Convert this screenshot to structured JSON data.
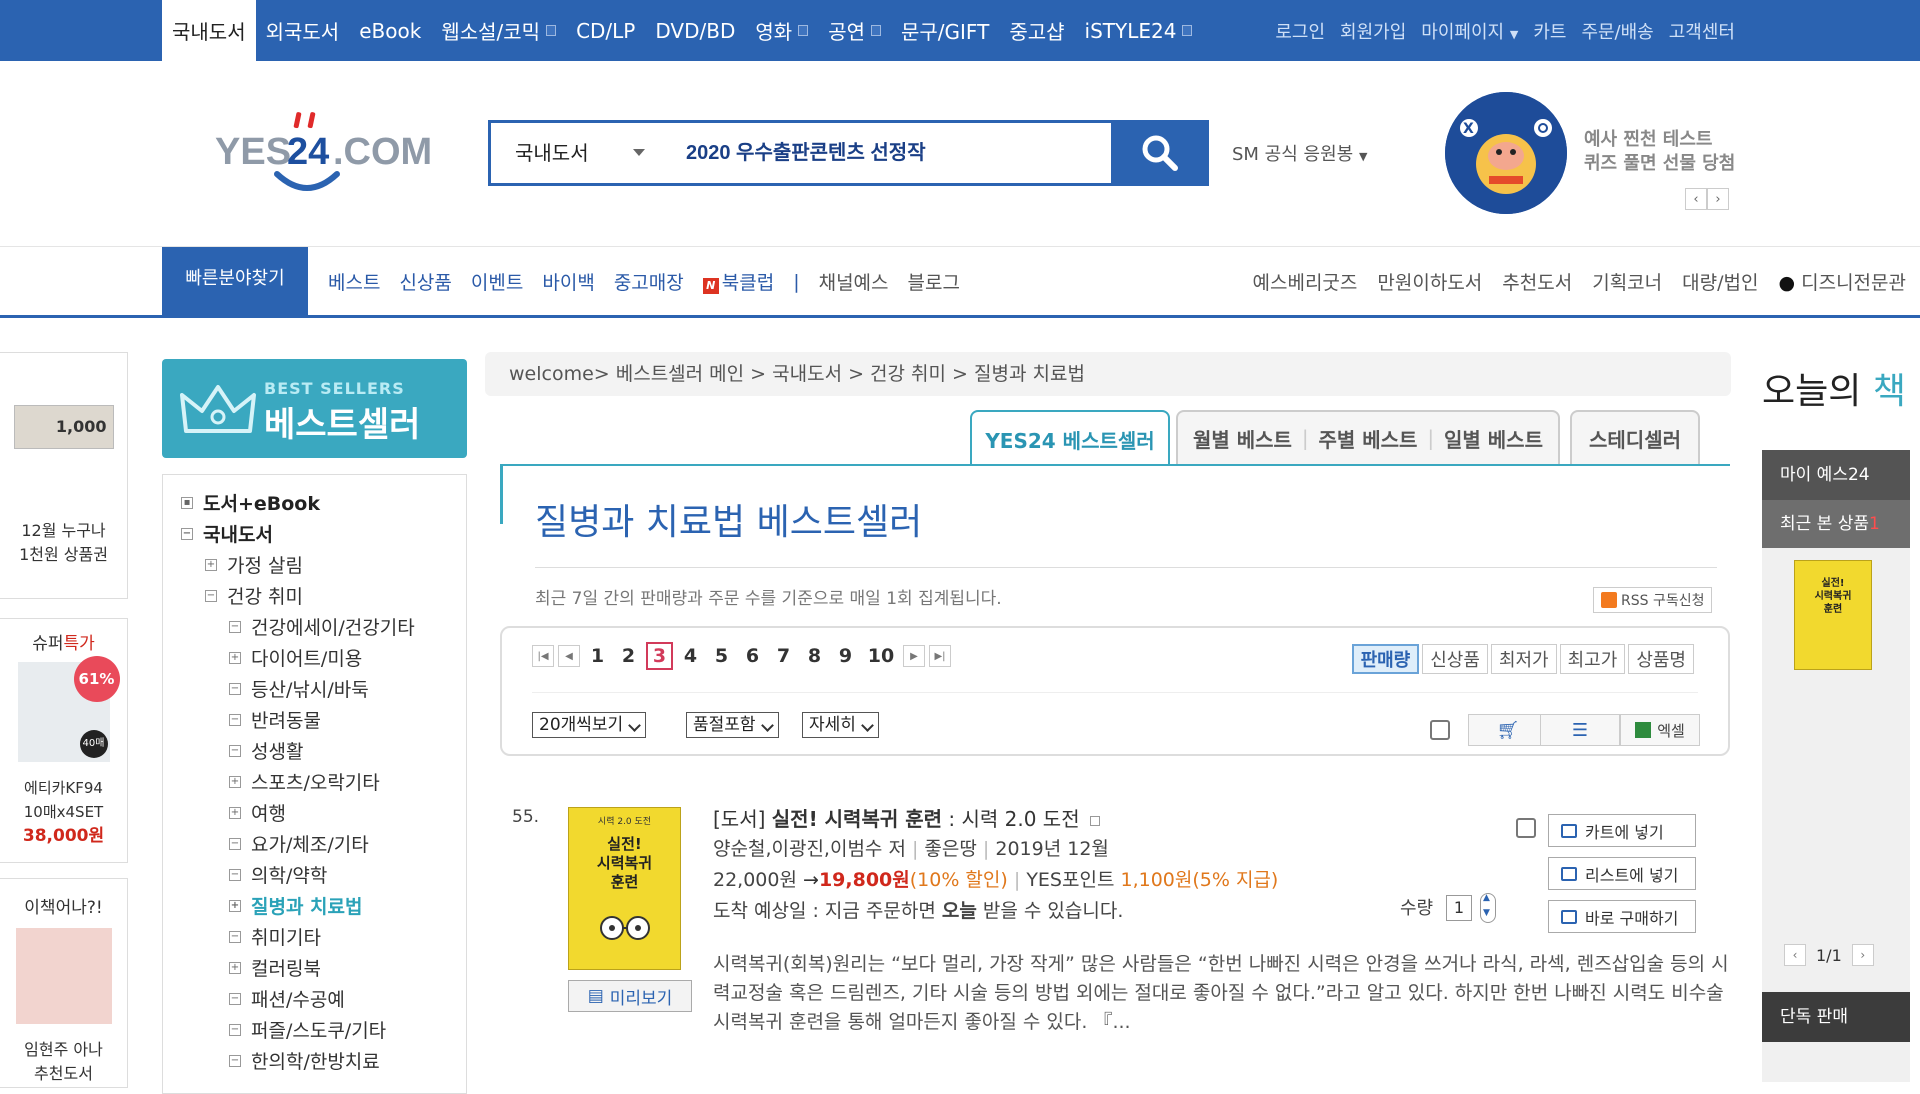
{
  "topbar": {
    "categories": [
      "국내도서",
      "외국도서",
      "eBook",
      "웹소설/코믹",
      "CD/LP",
      "DVD/BD",
      "영화",
      "공연",
      "문구/GIFT",
      "중고샵",
      "iSTYLE24"
    ],
    "util": [
      "로그인",
      "회원가입",
      "마이페이지",
      "카트",
      "주문/배송",
      "고객센터"
    ]
  },
  "logo": {
    "text_left": "YES",
    "text_num": "24",
    "text_right": ".COM"
  },
  "search": {
    "category": "국내도서",
    "keyword": "2020 우수출판콘텐츠 선정작"
  },
  "sm_support": "SM 공식 응원봉",
  "promo": {
    "line1": "예사 찐천 테스트",
    "line2": "퀴즈 풀면 선물 당첨"
  },
  "nav2": {
    "quick": "빠른분야찾기",
    "left": [
      "베스트",
      "신상품",
      "이벤트",
      "바이백",
      "중고매장",
      "북클럽",
      "채널예스",
      "블로그"
    ],
    "right": [
      "예스베리굿즈",
      "만원이하도서",
      "추천도서",
      "기획코너",
      "대량/법인",
      "디즈니전문관"
    ]
  },
  "left_ads": [
    {
      "price_img": "1,000",
      "label1": "12월 누구나",
      "label2": "1천원 상품권"
    },
    {
      "head_black": "슈퍼",
      "head_red": "특가",
      "badge": "61%",
      "count": "40매",
      "name1": "에티카KF94",
      "name2": "10매x4SET",
      "price": "38,000원"
    },
    {
      "head": "이책어나?!",
      "name1": "임현주 아나",
      "name2": "추천도서"
    }
  ],
  "bestseller": {
    "en": "BEST SELLERS",
    "ko": "베스트셀러"
  },
  "tree": [
    {
      "label": "도서+eBook",
      "level": 0
    },
    {
      "label": "국내도서",
      "level": 0
    },
    {
      "label": "가정 살림",
      "level": 1
    },
    {
      "label": "건강 취미",
      "level": 1
    },
    {
      "label": "건강에세이/건강기타",
      "level": 2
    },
    {
      "label": "다이어트/미용",
      "level": 2
    },
    {
      "label": "등산/낚시/바둑",
      "level": 2
    },
    {
      "label": "반려동물",
      "level": 2
    },
    {
      "label": "성생활",
      "level": 2
    },
    {
      "label": "스포츠/오락기타",
      "level": 2
    },
    {
      "label": "여행",
      "level": 2
    },
    {
      "label": "요가/체조/기타",
      "level": 2
    },
    {
      "label": "의학/약학",
      "level": 2
    },
    {
      "label": "질병과 치료법",
      "level": 2
    },
    {
      "label": "취미기타",
      "level": 2
    },
    {
      "label": "컬러링북",
      "level": 2
    },
    {
      "label": "패션/수공예",
      "level": 2
    },
    {
      "label": "퍼즐/스도쿠/기타",
      "level": 2
    },
    {
      "label": "한의학/한방치료",
      "level": 2
    }
  ],
  "breadcrumb": "welcome> 베스트셀러 메인 > 국내도서 > 건강 취미 > 질병과 치료법",
  "tabs": [
    "YES24 베스트셀러",
    "월별 베스트",
    "주별 베스트",
    "일별 베스트",
    "스테디셀러"
  ],
  "heading": "질병과 치료법 베스트셀러",
  "note": "최근 7일 간의 판매량과 주문 수를 기준으로 매일 1회 집계됩니다.",
  "rss": "RSS 구독신청",
  "pager": {
    "pages": [
      "1",
      "2",
      "3",
      "4",
      "5",
      "6",
      "7",
      "8",
      "9",
      "10"
    ],
    "current": "3"
  },
  "sorts": [
    "판매량",
    "신상품",
    "최저가",
    "최고가",
    "상품명"
  ],
  "dropdowns": [
    "20개씩보기",
    "품절포함",
    "자세히"
  ],
  "excel": "엑셀",
  "item": {
    "rank": "55.",
    "cover_top": "시력 2.0 도전",
    "cover_title1": "실전!",
    "cover_title2": "시력복귀",
    "cover_title3": "훈련",
    "preview": "미리보기",
    "type": "[도서]",
    "title": "실전! 시력복귀 훈련",
    "subtitle": ": 시력 2.0 도전",
    "authors": "양순철,이광진,이범수 저",
    "publisher": "좋은땅",
    "date": "2019년 12월",
    "list_price": "22,000원",
    "arrow": "→",
    "sale_price": "19,800원",
    "discount": "(10% 할인)",
    "points_label": "YES포인트",
    "points": "1,100원",
    "points_rate": "(5% 지급)",
    "delivery": "도착 예상일 : 지금 주문하면",
    "delivery_bold": "오늘",
    "delivery_tail": "받을 수 있습니다.",
    "qty_label": "수량",
    "qty": "1",
    "btn_cart": "카트에 넣기",
    "btn_list": "리스트에 넣기",
    "btn_buy": "바로 구매하기",
    "desc": "시력복귀(회복)원리는 “보다 멀리, 가장 작게” 많은 사람들은 “한번 나빠진 시력은 안경을 쓰거나 라식, 라섹, 렌즈삽입술 등의 시력교정술 혹은 드림렌즈, 기타 시술 등의 방법 외에는 절대로 좋아질 수 없다.”라고 알고 있다. 하지만 한번 나빠진 시력도 비수술 시력복귀 훈련을 통해 얼마든지 좋아질 수 있다. 『..."
  },
  "right": {
    "today1": "오늘의",
    "today2": "책",
    "my": "마이 예스24",
    "recent": "최근 본 상품",
    "recent_count": "1",
    "page": "1/1",
    "solo": "단독 판매"
  },
  "colors": {
    "brand": "#2b63b1",
    "accent": "#3aa8c0",
    "price": "#d0281c"
  }
}
